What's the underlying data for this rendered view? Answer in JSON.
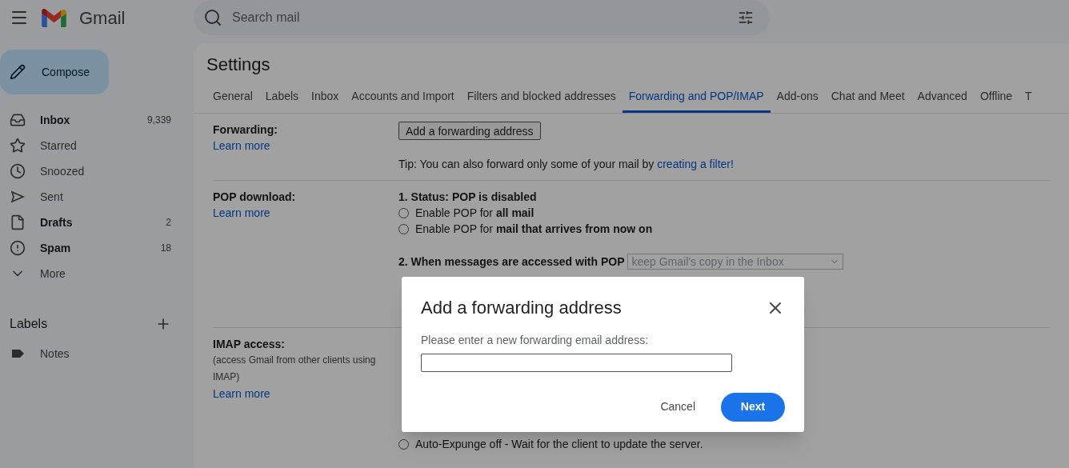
{
  "header": {
    "app_name": "Gmail",
    "search_placeholder": "Search mail"
  },
  "compose": "Compose",
  "nav": [
    {
      "kind": "inbox",
      "label": "Inbox",
      "count": "9,339",
      "unread": true
    },
    {
      "kind": "star",
      "label": "Starred",
      "unread": false
    },
    {
      "kind": "clock",
      "label": "Snoozed",
      "unread": false
    },
    {
      "kind": "sent",
      "label": "Sent",
      "unread": false
    },
    {
      "kind": "draft",
      "label": "Drafts",
      "count": "2",
      "unread": true
    },
    {
      "kind": "spam",
      "label": "Spam",
      "count": "18",
      "unread": true
    },
    {
      "kind": "more",
      "label": "More",
      "unread": false
    }
  ],
  "labels": {
    "title": "Labels",
    "items": [
      {
        "name": "Notes"
      }
    ]
  },
  "settings": {
    "title": "Settings",
    "tabs": [
      {
        "label": "General",
        "selected": false
      },
      {
        "label": "Labels",
        "selected": false
      },
      {
        "label": "Inbox",
        "selected": false
      },
      {
        "label": "Accounts and Import",
        "selected": false
      },
      {
        "label": "Filters and blocked addresses",
        "selected": false
      },
      {
        "label": "Forwarding and POP/IMAP",
        "selected": true
      },
      {
        "label": "Add-ons",
        "selected": false
      },
      {
        "label": "Chat and Meet",
        "selected": false
      },
      {
        "label": "Advanced",
        "selected": false
      },
      {
        "label": "Offline",
        "selected": false
      },
      {
        "label": "T",
        "selected": false
      }
    ],
    "forwarding": {
      "label": "Forwarding:",
      "link": "Learn more",
      "button": "Add a forwarding address",
      "tip": "Tip: You can also forward only some of your mail by",
      "tip_link": "creating a filter!"
    },
    "pop": {
      "label": "POP download:",
      "link": "Learn more",
      "status": "1. Status: POP is disabled",
      "options": [
        {
          "label": "Enable POP for **all mail**",
          "selected": false
        },
        {
          "label": "Enable POP for **mail that arrives from now on**",
          "selected": false
        }
      ],
      "step2": "2. When messages are accessed with POP",
      "step2_value": "keep Gmail's copy in the Inbox"
    },
    "imap": {
      "label": "IMAP access:",
      "note": "(access Gmail from other clients using IMAP)",
      "link": "Learn more",
      "expunge_options": [
        {
          "label": "Auto-Expunge off - Wait for the client to update the server.",
          "selected": false
        }
      ]
    }
  },
  "dialog": {
    "title": "Add a forwarding address",
    "prompt": "Please enter a new forwarding email address:",
    "cancel": "Cancel",
    "next": "Next"
  }
}
